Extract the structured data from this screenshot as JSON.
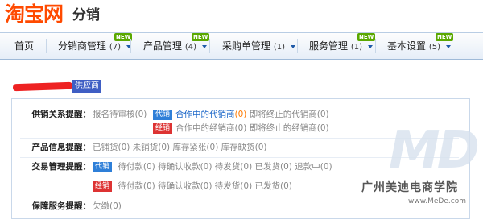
{
  "header": {
    "logo_text": "淘宝网",
    "section_title": "分销"
  },
  "nav": {
    "items": [
      {
        "label": "首页",
        "count": "",
        "has_menu": false,
        "new": false
      },
      {
        "label": "分销商管理",
        "count": "(7)",
        "has_menu": true,
        "new": true
      },
      {
        "label": "产品管理",
        "count": "(4)",
        "has_menu": true,
        "new": true
      },
      {
        "label": "采购单管理",
        "count": "(1)",
        "has_menu": true,
        "new": false
      },
      {
        "label": "服务管理",
        "count": "(1)",
        "has_menu": true,
        "new": true
      },
      {
        "label": "基本设置",
        "count": "(5)",
        "has_menu": true,
        "new": true
      }
    ],
    "new_badge_label": "NEW"
  },
  "account": {
    "role_tag": "供应商"
  },
  "alerts": {
    "distribution": {
      "label": "供销关系提醒：",
      "pending_review": "报名待审核(0)",
      "agent_tag": "代销",
      "agent_cooperating_prefix": "合作中的代销商",
      "agent_cooperating_count": "(0)",
      "agent_ending": "即将终止的代销商(0)",
      "dealer_tag": "经销",
      "dealer_cooperating": "合作中的经销商(0)",
      "dealer_ending": "即将终止的经销商(0)"
    },
    "product": {
      "label": "产品信息提醒：",
      "items": [
        "已铺货(0)",
        "未铺货(0)",
        "库存紧张(0)",
        "库存缺货(0)"
      ]
    },
    "trade": {
      "label": "交易管理提醒：",
      "agent_tag": "代销",
      "agent_items": [
        "待付款(0)",
        "待确认收款(0)",
        "待发货(0)",
        "已发货(0)",
        "退款中(0)"
      ],
      "dealer_tag": "经销",
      "dealer_items": [
        "待付款(0)",
        "待确认收款(0)",
        "待发货(0)",
        "已发货(0)"
      ]
    },
    "guarantee": {
      "label": "保障服务提醒：",
      "items": [
        "欠缴(0)"
      ]
    }
  },
  "watermark": {
    "logo": "MD",
    "name": "广州美迪电商学院",
    "url": "www.MeDe.com"
  },
  "colors": {
    "logo_orange": "#ff4a00",
    "link_blue": "#1a66c8",
    "count_orange": "#ff7a00",
    "agent_tag": "#2e7fd8",
    "dealer_tag": "#d33333",
    "supplier_tag": "#3f5ec4",
    "new_badge": "#5aa800"
  }
}
